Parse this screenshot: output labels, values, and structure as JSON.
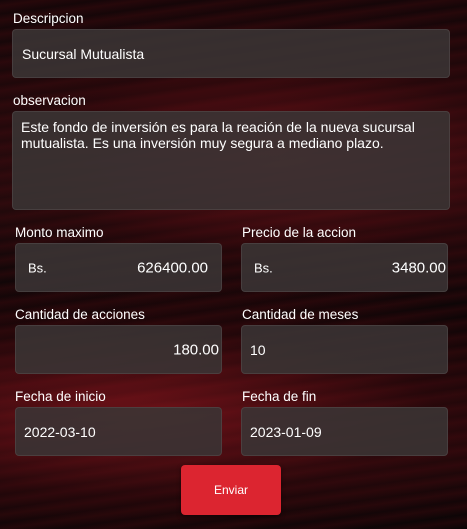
{
  "form": {
    "descripcion": {
      "label": "Descripcion",
      "value": "Sucursal Mutualista"
    },
    "observacion": {
      "label": "observacion",
      "value": "Este fondo de inversión es para la reación de la nueva sucursal mutualista. Es una inversión muy segura a mediano plazo."
    },
    "monto_maximo": {
      "label": "Monto maximo",
      "prefix": "Bs.",
      "value": "626400.00"
    },
    "precio_accion": {
      "label": "Precio de la accion",
      "prefix": "Bs.",
      "value": "3480.00"
    },
    "cantidad_acciones": {
      "label": "Cantidad de acciones",
      "value": "180.00"
    },
    "cantidad_meses": {
      "label": "Cantidad de meses",
      "value": "10"
    },
    "fecha_inicio": {
      "label": "Fecha de inicio",
      "value": "2022-03-10"
    },
    "fecha_fin": {
      "label": "Fecha de fin",
      "value": "2023-01-09"
    },
    "submit_label": "Enviar"
  }
}
